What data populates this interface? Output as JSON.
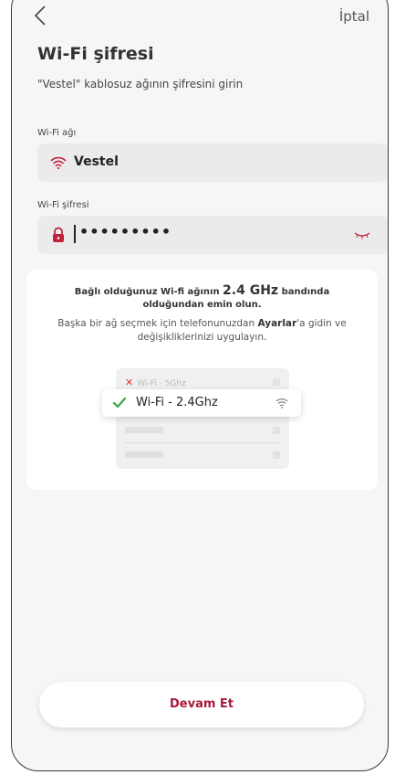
{
  "header": {
    "cancel_label": "İptal"
  },
  "page": {
    "title": "Wi-Fi şifresi",
    "subtitle": "\"Vestel\" kablosuz ağının şifresini girin"
  },
  "network_field": {
    "label": "Wi-Fi ağı",
    "value": "Vestel"
  },
  "password_field": {
    "label": "Wi-Fi şifresi",
    "masked_value": "•••••••••"
  },
  "info": {
    "line1_prefix": "Bağlı olduğunuz Wi-fi ağının",
    "line1_freq": "2.4 GHz",
    "line1_suffix": "bandında olduğundan emin olun.",
    "line2_prefix": "Başka bir ağ seçmek için telefonunuzdan",
    "line2_bold": "Ayarlar",
    "line2_suffix": "'a gidin ve değişikliklerinizi uygulayın.",
    "mock_unselected": "Wi-Fi - 5Ghz",
    "mock_selected": "Wi-Fi - 2.4Ghz"
  },
  "actions": {
    "continue_label": "Devam Et"
  },
  "colors": {
    "accent": "#a8173d",
    "check": "#3aa34a",
    "cross": "#e23333"
  },
  "icons": {
    "back": "chevron-left-icon",
    "wifi": "wifi-icon",
    "lock": "lock-icon",
    "eye": "eye-closed-icon",
    "check": "check-icon",
    "cross": "close-icon"
  }
}
